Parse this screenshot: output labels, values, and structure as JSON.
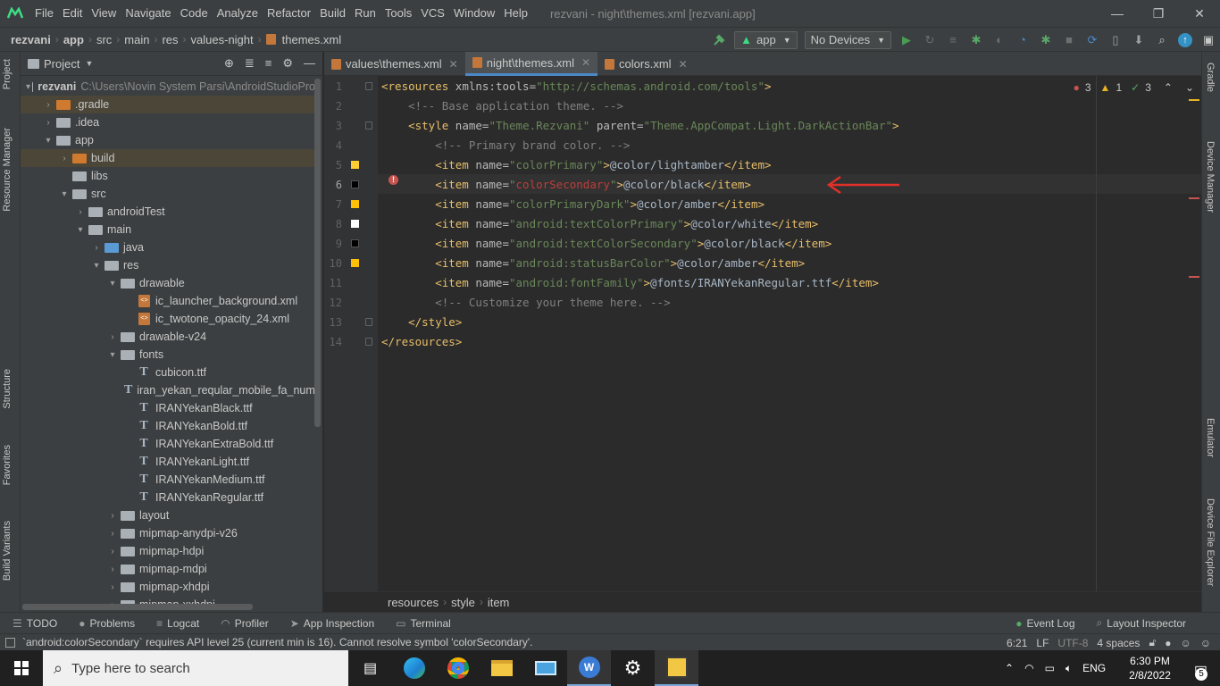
{
  "menubar": {
    "items": [
      "File",
      "Edit",
      "View",
      "Navigate",
      "Code",
      "Analyze",
      "Refactor",
      "Build",
      "Run",
      "Tools",
      "VCS",
      "Window",
      "Help"
    ],
    "title": "rezvani - night\\themes.xml [rezvani.app]",
    "controls": [
      "—",
      "❐",
      "✕"
    ]
  },
  "navbar": {
    "crumbs": [
      "rezvani",
      "app",
      "src",
      "main",
      "res",
      "values-night",
      "themes.xml"
    ],
    "run_config": "app",
    "device": "No Devices"
  },
  "left_strip": {
    "tabs": [
      "Project",
      "Resource Manager",
      "Structure",
      "Favorites",
      "Build Variants"
    ]
  },
  "right_strip": {
    "tabs": [
      "Gradle",
      "Device Manager",
      "Emulator",
      "Device File Explorer"
    ]
  },
  "project": {
    "title": "Project",
    "tree": [
      {
        "label": "rezvani",
        "extra": "C:\\Users\\Novin System Parsi\\AndroidStudioPro",
        "icon": "grey",
        "chev": "▾",
        "depth": 0,
        "bold": true
      },
      {
        "label": ".gradle",
        "icon": "orange",
        "chev": "›",
        "depth": 1,
        "sel": true
      },
      {
        "label": ".idea",
        "icon": "grey",
        "chev": "›",
        "depth": 1
      },
      {
        "label": "app",
        "icon": "grey",
        "chev": "▾",
        "depth": 1
      },
      {
        "label": "build",
        "icon": "orange",
        "chev": "›",
        "depth": 2,
        "sel": true
      },
      {
        "label": "libs",
        "icon": "grey",
        "chev": "",
        "depth": 2
      },
      {
        "label": "src",
        "icon": "grey",
        "chev": "▾",
        "depth": 2
      },
      {
        "label": "androidTest",
        "icon": "grey",
        "chev": "›",
        "depth": 3
      },
      {
        "label": "main",
        "icon": "grey",
        "chev": "▾",
        "depth": 3
      },
      {
        "label": "java",
        "icon": "blue",
        "chev": "›",
        "depth": 4
      },
      {
        "label": "res",
        "icon": "grey",
        "chev": "▾",
        "depth": 4
      },
      {
        "label": "drawable",
        "icon": "grey",
        "chev": "▾",
        "depth": 5
      },
      {
        "label": "ic_launcher_background.xml",
        "icon": "xml",
        "chev": "",
        "depth": 6
      },
      {
        "label": "ic_twotone_opacity_24.xml",
        "icon": "xml",
        "chev": "",
        "depth": 6
      },
      {
        "label": "drawable-v24",
        "icon": "grey",
        "chev": "›",
        "depth": 5
      },
      {
        "label": "fonts",
        "icon": "grey",
        "chev": "▾",
        "depth": 5
      },
      {
        "label": "cubicon.ttf",
        "icon": "ttf",
        "chev": "",
        "depth": 6
      },
      {
        "label": "iran_yekan_reqular_mobile_fa_num.",
        "icon": "ttf",
        "chev": "",
        "depth": 6
      },
      {
        "label": "IRANYekanBlack.ttf",
        "icon": "ttf",
        "chev": "",
        "depth": 6
      },
      {
        "label": "IRANYekanBold.ttf",
        "icon": "ttf",
        "chev": "",
        "depth": 6
      },
      {
        "label": "IRANYekanExtraBold.ttf",
        "icon": "ttf",
        "chev": "",
        "depth": 6
      },
      {
        "label": "IRANYekanLight.ttf",
        "icon": "ttf",
        "chev": "",
        "depth": 6
      },
      {
        "label": "IRANYekanMedium.ttf",
        "icon": "ttf",
        "chev": "",
        "depth": 6
      },
      {
        "label": "IRANYekanRegular.ttf",
        "icon": "ttf",
        "chev": "",
        "depth": 6
      },
      {
        "label": "layout",
        "icon": "grey",
        "chev": "›",
        "depth": 5
      },
      {
        "label": "mipmap-anydpi-v26",
        "icon": "grey",
        "chev": "›",
        "depth": 5
      },
      {
        "label": "mipmap-hdpi",
        "icon": "grey",
        "chev": "›",
        "depth": 5
      },
      {
        "label": "mipmap-mdpi",
        "icon": "grey",
        "chev": "›",
        "depth": 5
      },
      {
        "label": "mipmap-xhdpi",
        "icon": "grey",
        "chev": "›",
        "depth": 5
      },
      {
        "label": "mipmap-xxhdpi",
        "icon": "grey",
        "chev": "›",
        "depth": 5
      }
    ]
  },
  "editor": {
    "tabs": [
      {
        "label": "values\\themes.xml",
        "active": false
      },
      {
        "label": "night\\themes.xml",
        "active": true
      },
      {
        "label": "colors.xml",
        "active": false
      }
    ],
    "inspections": {
      "errors": "3",
      "warnings": "1",
      "typos": "3"
    },
    "line_numbers": [
      "1",
      "2",
      "3",
      "4",
      "5",
      "6",
      "7",
      "8",
      "9",
      "10",
      "11",
      "12",
      "13",
      "14"
    ],
    "swatches": [
      {
        "line": 5,
        "color": "#ffcc33"
      },
      {
        "line": 6,
        "color": "#000000"
      },
      {
        "line": 7,
        "color": "#ffc107"
      },
      {
        "line": 8,
        "color": "#ffffff"
      },
      {
        "line": 9,
        "color": "#000000"
      },
      {
        "line": 10,
        "color": "#ffc107"
      }
    ],
    "lines": [
      [
        {
          "t": "t",
          "s": "<resources "
        },
        {
          "t": "a",
          "s": "xmlns:tools="
        },
        {
          "t": "v",
          "s": "\"http://schemas.android.com/tools\""
        },
        {
          "t": "t",
          "s": ">"
        }
      ],
      [
        {
          "t": "c",
          "s": "    <!-- Base application theme. -->"
        }
      ],
      [
        {
          "t": "t",
          "s": "    <style "
        },
        {
          "t": "a",
          "s": "name="
        },
        {
          "t": "v",
          "s": "\"Theme.Rezvani\""
        },
        {
          "t": "a",
          "s": " parent="
        },
        {
          "t": "v",
          "s": "\"Theme.AppCompat.Light.DarkActionBar\""
        },
        {
          "t": "t",
          "s": ">"
        }
      ],
      [
        {
          "t": "c",
          "s": "        <!-- Primary brand color. -->"
        }
      ],
      [
        {
          "t": "t",
          "s": "        <item "
        },
        {
          "t": "a",
          "s": "name="
        },
        {
          "t": "v",
          "s": "\"colorPrimary\""
        },
        {
          "t": "t",
          "s": ">"
        },
        {
          "t": "n",
          "s": "@color/lightamber"
        },
        {
          "t": "t",
          "s": "</item>"
        }
      ],
      [
        {
          "t": "t",
          "s": "        <item "
        },
        {
          "t": "a",
          "s": "name="
        },
        {
          "t": "v",
          "s": "\""
        },
        {
          "t": "err",
          "s": "colorSecondary"
        },
        {
          "t": "v",
          "s": "\""
        },
        {
          "t": "t",
          "s": ">"
        },
        {
          "t": "n",
          "s": "@color/black"
        },
        {
          "t": "t",
          "s": "</item>"
        }
      ],
      [
        {
          "t": "t",
          "s": "        <item "
        },
        {
          "t": "a",
          "s": "name="
        },
        {
          "t": "v",
          "s": "\"colorPrimaryDark\""
        },
        {
          "t": "t",
          "s": ">"
        },
        {
          "t": "n",
          "s": "@color/amber"
        },
        {
          "t": "t",
          "s": "</item>"
        }
      ],
      [
        {
          "t": "t",
          "s": "        <item "
        },
        {
          "t": "a",
          "s": "name="
        },
        {
          "t": "v",
          "s": "\"android:textColorPrimary\""
        },
        {
          "t": "t",
          "s": ">"
        },
        {
          "t": "n",
          "s": "@color/white"
        },
        {
          "t": "t",
          "s": "</item>"
        }
      ],
      [
        {
          "t": "t",
          "s": "        <item "
        },
        {
          "t": "a",
          "s": "name="
        },
        {
          "t": "v",
          "s": "\"android:textColorSecondary\""
        },
        {
          "t": "t",
          "s": ">"
        },
        {
          "t": "n",
          "s": "@color/black"
        },
        {
          "t": "t",
          "s": "</item>"
        }
      ],
      [
        {
          "t": "t",
          "s": "        <item "
        },
        {
          "t": "a",
          "s": "name="
        },
        {
          "t": "v",
          "s": "\"android:statusBarColor\""
        },
        {
          "t": "t",
          "s": ">"
        },
        {
          "t": "n",
          "s": "@color/amber"
        },
        {
          "t": "t",
          "s": "</item>"
        }
      ],
      [
        {
          "t": "t",
          "s": "        <item "
        },
        {
          "t": "a",
          "s": "name="
        },
        {
          "t": "v",
          "s": "\"android:fontFamily\""
        },
        {
          "t": "t",
          "s": ">"
        },
        {
          "t": "n",
          "s": "@fonts/IRANYekanRegular.ttf"
        },
        {
          "t": "t",
          "s": "</item>"
        }
      ],
      [
        {
          "t": "c",
          "s": "        <!-- Customize your theme here. -->"
        }
      ],
      [
        {
          "t": "t",
          "s": "    </style>"
        }
      ],
      [
        {
          "t": "t",
          "s": "</resources>"
        }
      ]
    ],
    "breadcrumb": [
      "resources",
      "style",
      "item"
    ]
  },
  "bottom_tools": {
    "left": [
      "TODO",
      "Problems",
      "Logcat",
      "Profiler",
      "App Inspection",
      "Terminal"
    ],
    "right": [
      "Event Log",
      "Layout Inspector"
    ]
  },
  "status": {
    "message": "`android:colorSecondary` requires API level 25 (current min is 16). Cannot resolve symbol 'colorSecondary'.",
    "position": "6:21",
    "line_sep": "LF",
    "encoding": "UTF-8",
    "indent": "4 spaces"
  },
  "taskbar": {
    "search_placeholder": "Type here to search",
    "lang": "ENG",
    "time": "6:30 PM",
    "date": "2/8/2022",
    "notif_count": "5"
  }
}
